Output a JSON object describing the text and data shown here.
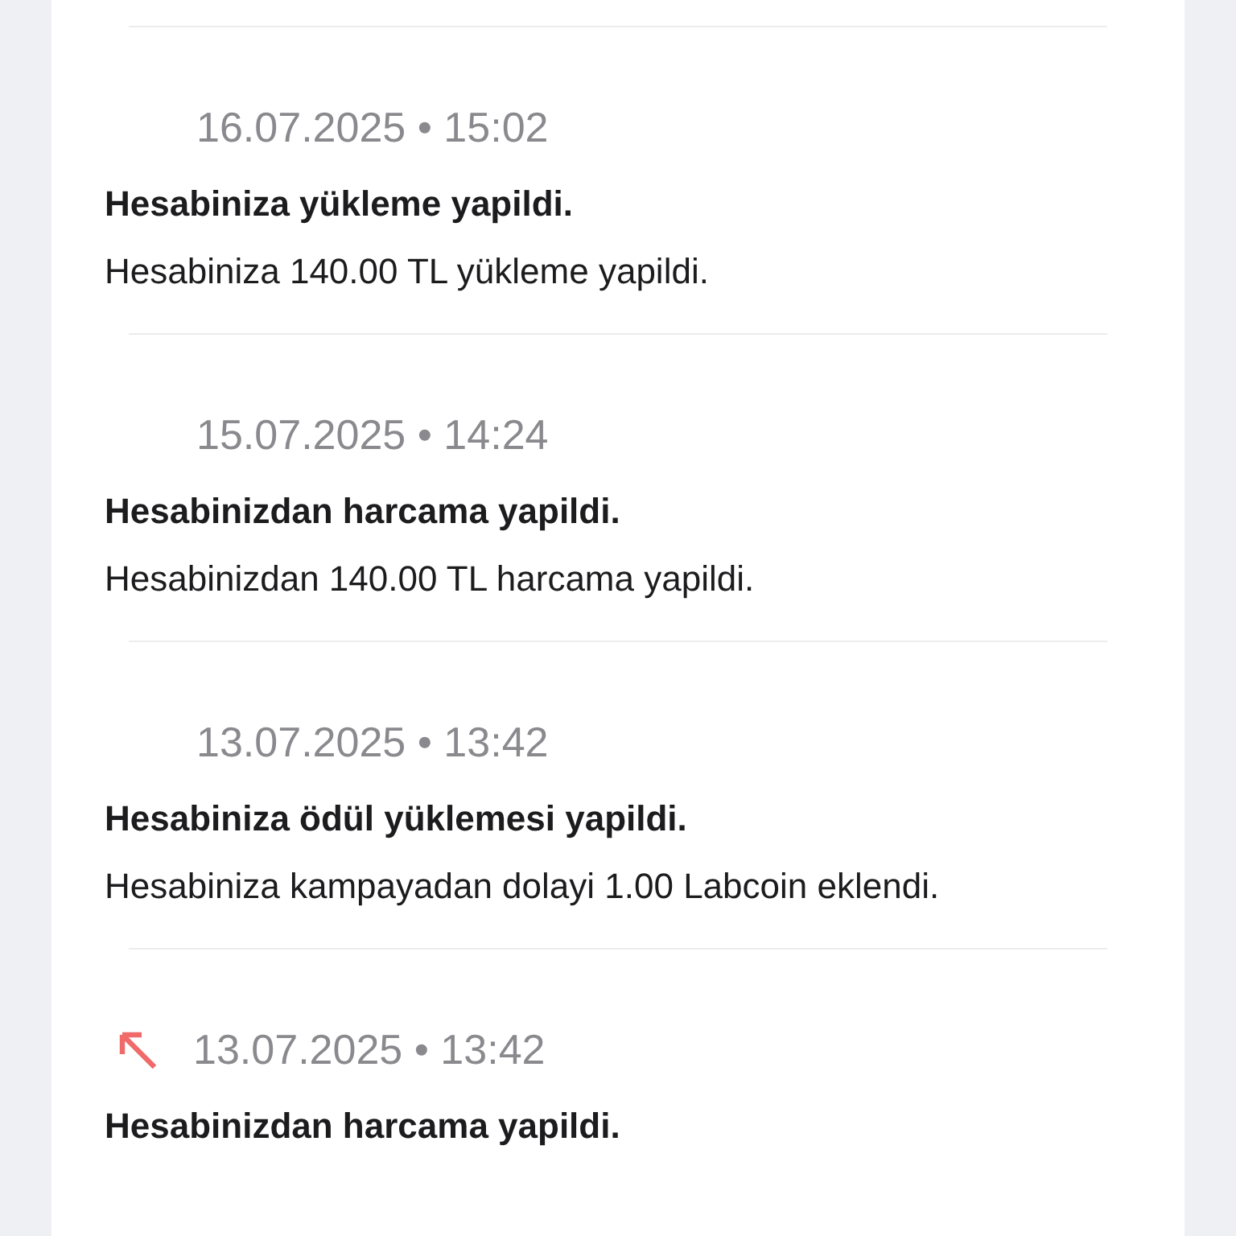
{
  "notifications": [
    {
      "kind": "plain",
      "date": "16.07.2025 • 15:02",
      "title": "Hesabiniza yükleme yapildi.",
      "body": "Hesabiniza 140.00 TL yükleme yapildi."
    },
    {
      "kind": "plain",
      "date": "15.07.2025 • 14:24",
      "title": "Hesabinizdan harcama yapildi.",
      "body": "Hesabinizdan 140.00 TL harcama yapildi."
    },
    {
      "kind": "plain",
      "date": "13.07.2025 • 13:42",
      "title": "Hesabiniza ödül yüklemesi yapildi.",
      "body": "Hesabiniza kampayadan dolayi 1.00 Labcoin eklendi."
    },
    {
      "kind": "outgoing",
      "date": "13.07.2025 • 13:42",
      "title": "Hesabinizdan harcama yapildi."
    }
  ]
}
